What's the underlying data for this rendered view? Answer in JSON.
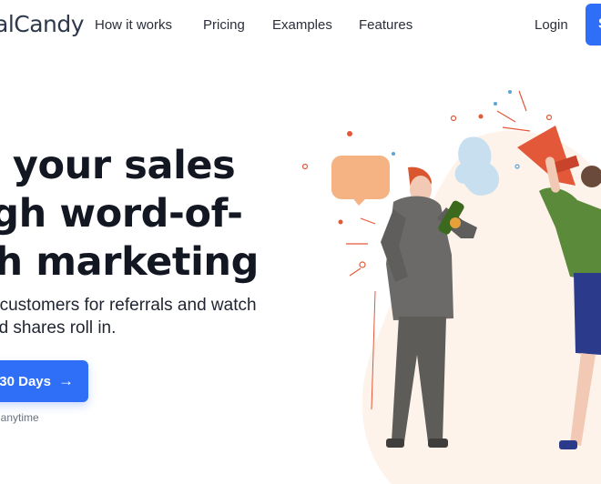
{
  "header": {
    "logo_text": "alCandy",
    "nav": [
      {
        "label": "How it works"
      },
      {
        "label": "Pricing"
      },
      {
        "label": "Examples"
      },
      {
        "label": "Features"
      }
    ],
    "login_label": "Login",
    "cta_label": "S"
  },
  "hero": {
    "headline_lines": [
      "w your sales",
      "ugh word-of-",
      "ıth marketing"
    ],
    "subtext_lines": [
      "r customers for referrals and watch",
      "nd shares roll in."
    ],
    "button_label": "30 Days",
    "button_icon": "arrow-right-icon",
    "cancel_note": "el anytime"
  },
  "colors": {
    "primary": "#2f6ff7",
    "headline": "#131722",
    "speech_bubble": "#f5b283",
    "megaphone": "#e4583a",
    "bottle": "#3b6a1f",
    "blob_background": "#fdf3ea"
  }
}
